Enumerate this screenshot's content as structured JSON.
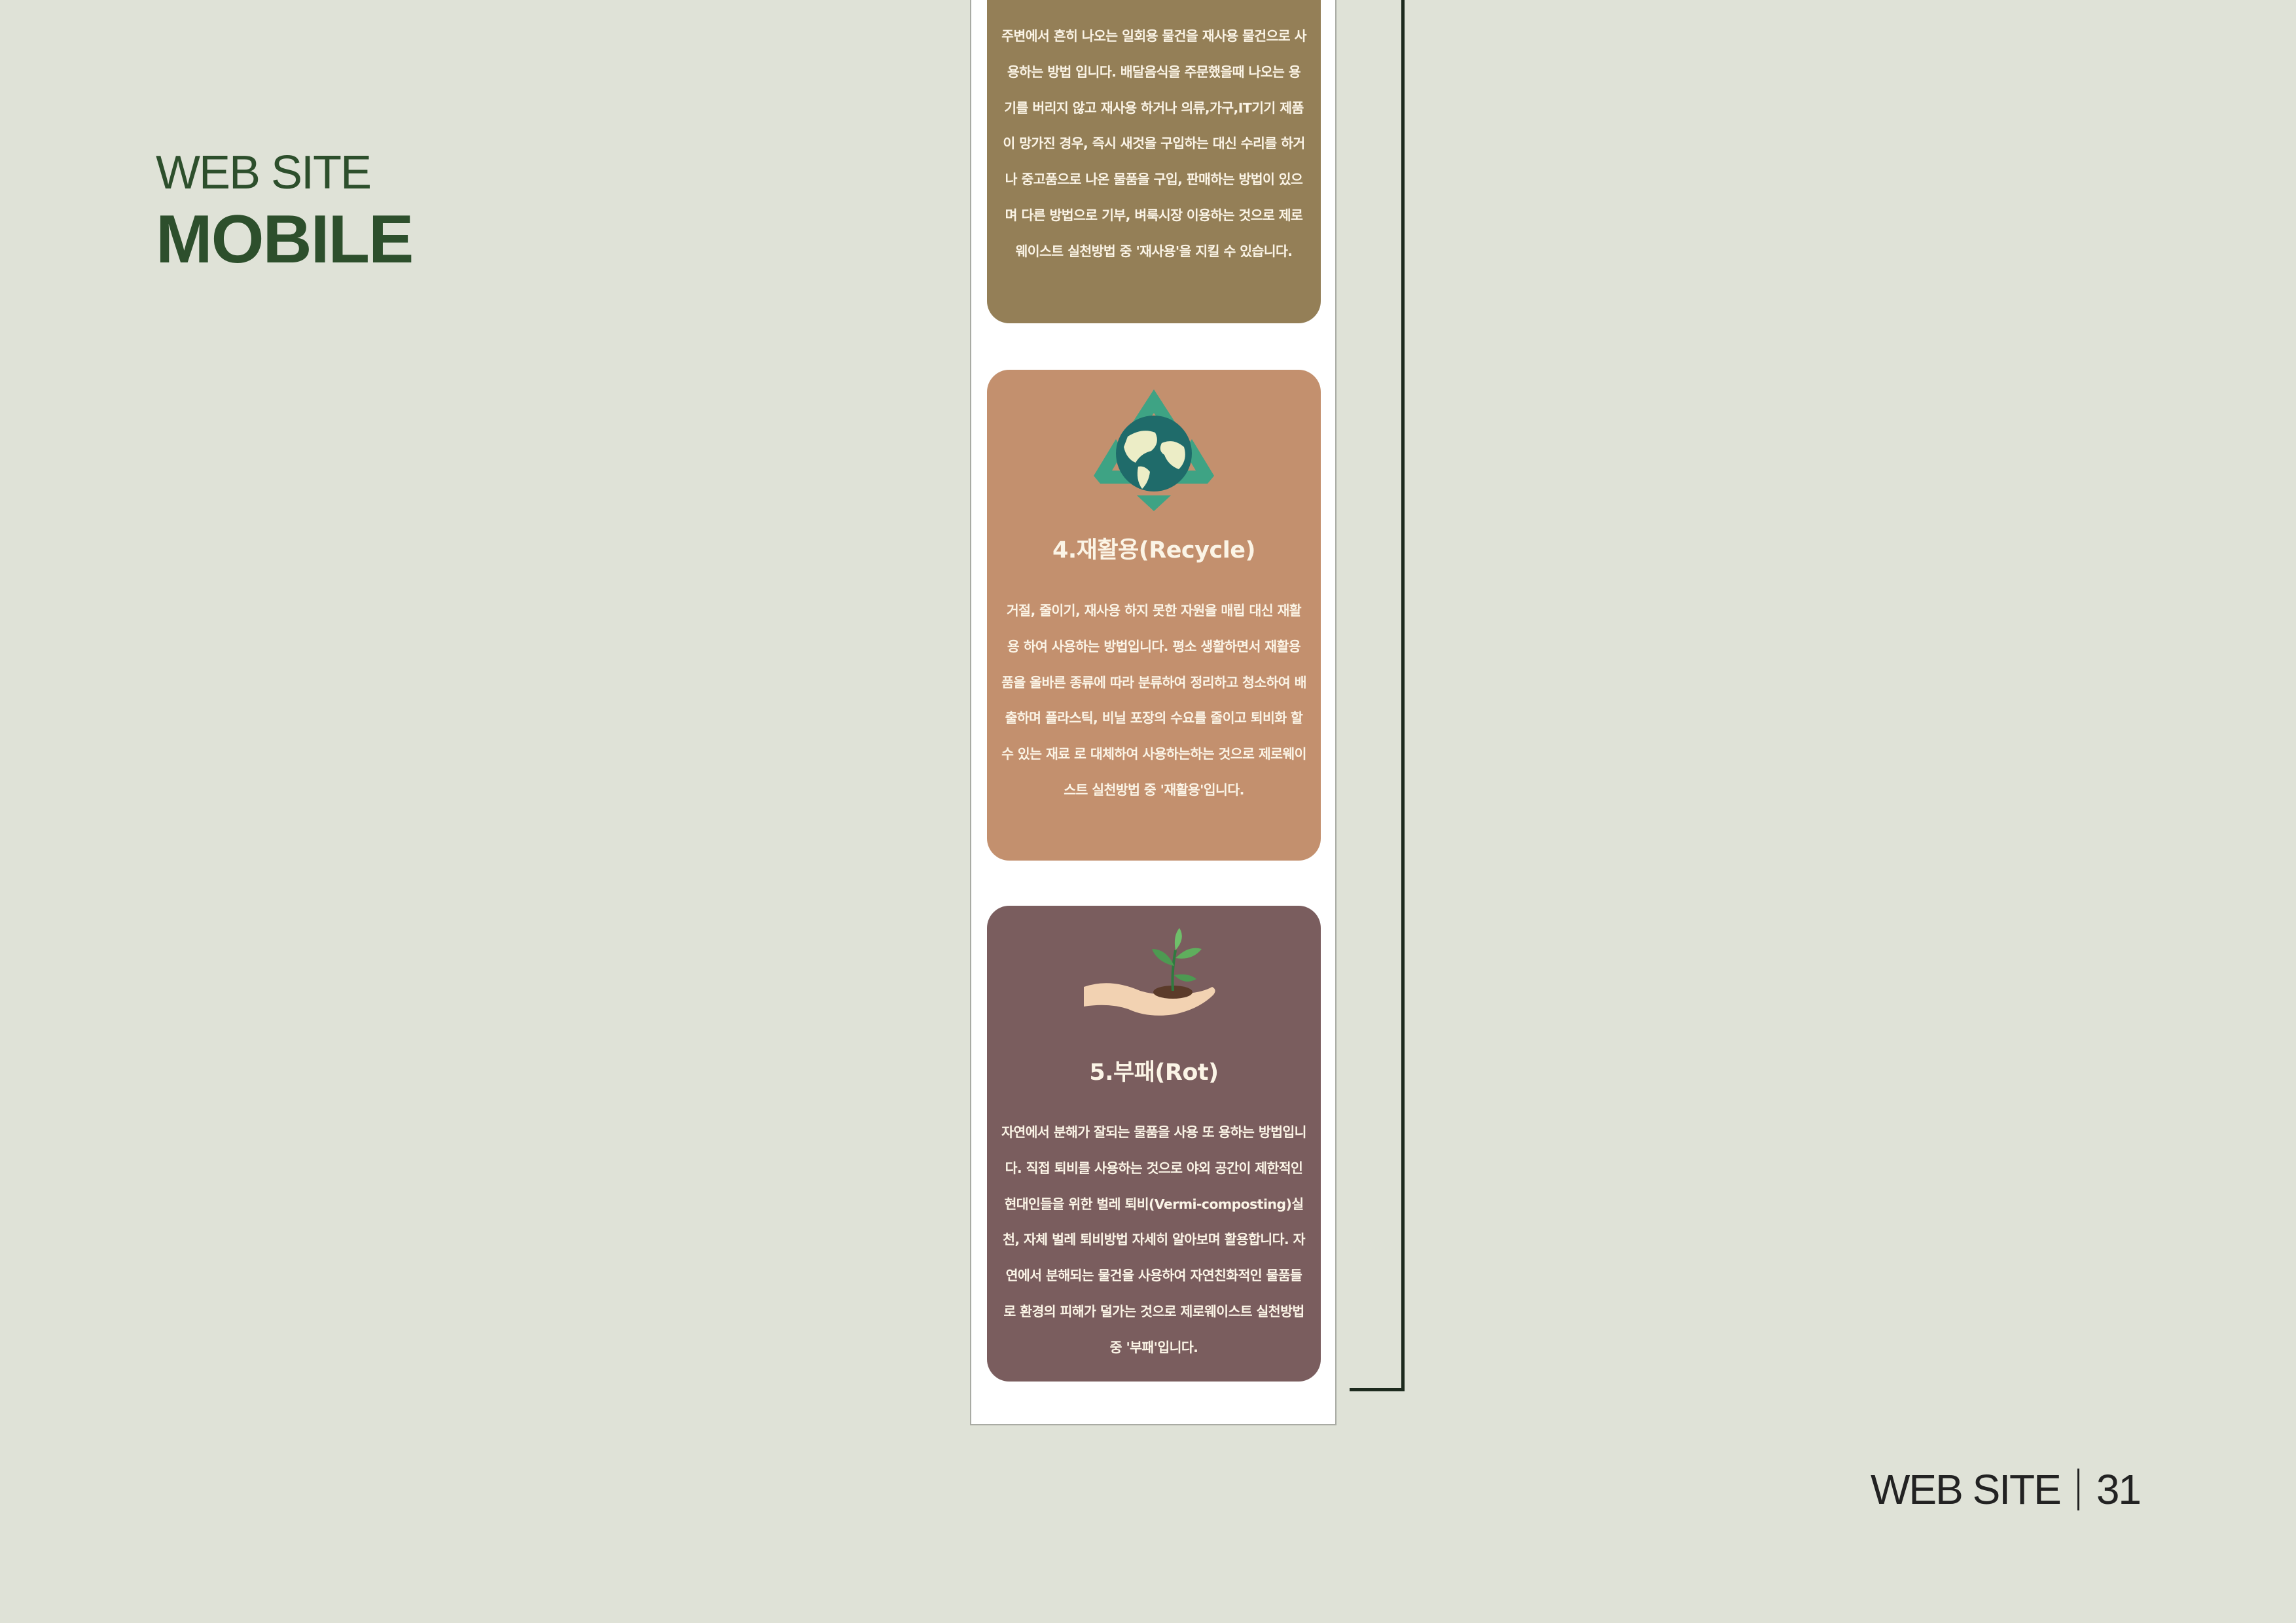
{
  "heading": {
    "sub": "WEB SITE",
    "main": "MOBILE"
  },
  "cards": [
    {
      "title": "",
      "text": "주변에서 흔히 나오는 일회용 물건을 재사용 물건으로 사용하는 방법 입니다. 배달음식을 주문했을때 나오는 용기를 버리지 않고 재사용 하거나 의류,가구,IT기기 제품이 망가진 경우, 즉시 새것을 구입하는 대신 수리를 하거나 중고품으로 나온 물품을 구입, 판매하는 방법이 있으며 다른 방법으로 기부, 벼룩시장 이용하는 것으로 제로웨이스트 실천방법 중 '재사용'을 지킬 수 있습니다.",
      "color": "#947f57"
    },
    {
      "title": "4.재활용(Recycle)",
      "text": "거절, 줄이기, 재사용 하지 못한 자원을 매립 대신 재활용 하여 사용하는 방법입니다. 평소 생활하면서 재활용품을 올바른 종류에 따라 분류하여 정리하고 청소하여 배출하며 플라스틱, 비닐 포장의 수요를 줄이고 퇴비화 할 수 있는 재료 로 대체하여 사용하는하는 것으로 제로웨이스트 실천방법 중 '재활용'입니다.",
      "icon": "recycle-globe-icon",
      "color": "#c3906e"
    },
    {
      "title": "5.부패(Rot)",
      "text": "자연에서 분해가 잘되는 물품을 사용 또 용하는 방법입니다. 직접 퇴비를 사용하는 것으로 야외 공간이 제한적인 현대인들을 위한 벌레 퇴비(Vermi-composting)실천, 자체 벌레 퇴비방법 자세히 알아보며 활용합니다. 자연에서 분해되는 물건을 사용하여 자연친화적인 물품들로 환경의 피해가 덜가는 것으로 제로웨이스트 실천방법 중 '부패'입니다.",
      "icon": "hand-sprout-icon",
      "color": "#7a5d5e"
    }
  ],
  "footer": {
    "section": "WEB SITE",
    "page": "31"
  }
}
